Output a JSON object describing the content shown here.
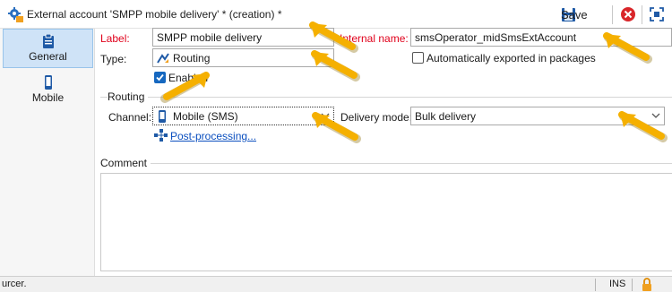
{
  "window": {
    "title": "External account 'SMPP mobile delivery' * (creation) *",
    "title_icon": "gear-account-icon"
  },
  "toolbar": {
    "save_label": "Save",
    "save_icon": "floppy-disk-icon",
    "cancel_icon": "red-circle-x-icon",
    "fullscreen_icon": "focus-frame-icon"
  },
  "sidebar": {
    "items": [
      {
        "label": "General",
        "icon": "clipboard-icon",
        "active": true
      },
      {
        "label": "Mobile",
        "icon": "mobile-phone-icon",
        "active": false
      }
    ]
  },
  "form": {
    "label_caption": "Label:",
    "label_value": "SMPP mobile delivery",
    "internal_name_caption": "Internal name:",
    "internal_name_value": "smsOperator_midSmsExtAccount",
    "type_caption": "Type:",
    "type_value": "Routing",
    "type_icon": "routing-icon",
    "auto_export_label": "Automatically exported in packages",
    "auto_export_checked": false,
    "enabled_label": "Enabled",
    "enabled_checked": true
  },
  "routing": {
    "group_title": "Routing",
    "channel_caption": "Channel:",
    "channel_value": "Mobile (SMS)",
    "channel_icon": "mobile-phone-icon",
    "delivery_mode_caption": "Delivery mode:",
    "delivery_mode_value": "Bulk delivery",
    "post_processing_link": "Post-processing...",
    "post_processing_icon": "workflow-icon"
  },
  "comment": {
    "group_title": "Comment",
    "value": ""
  },
  "status_bar": {
    "text": "urcer.",
    "mode": "INS",
    "lock_icon": "padlock-icon"
  },
  "colors": {
    "required_label": "#e0001b",
    "link": "#0b4fbf",
    "active_tab_bg": "#cfe3f7",
    "annotation_arrow": "#f5b000"
  }
}
